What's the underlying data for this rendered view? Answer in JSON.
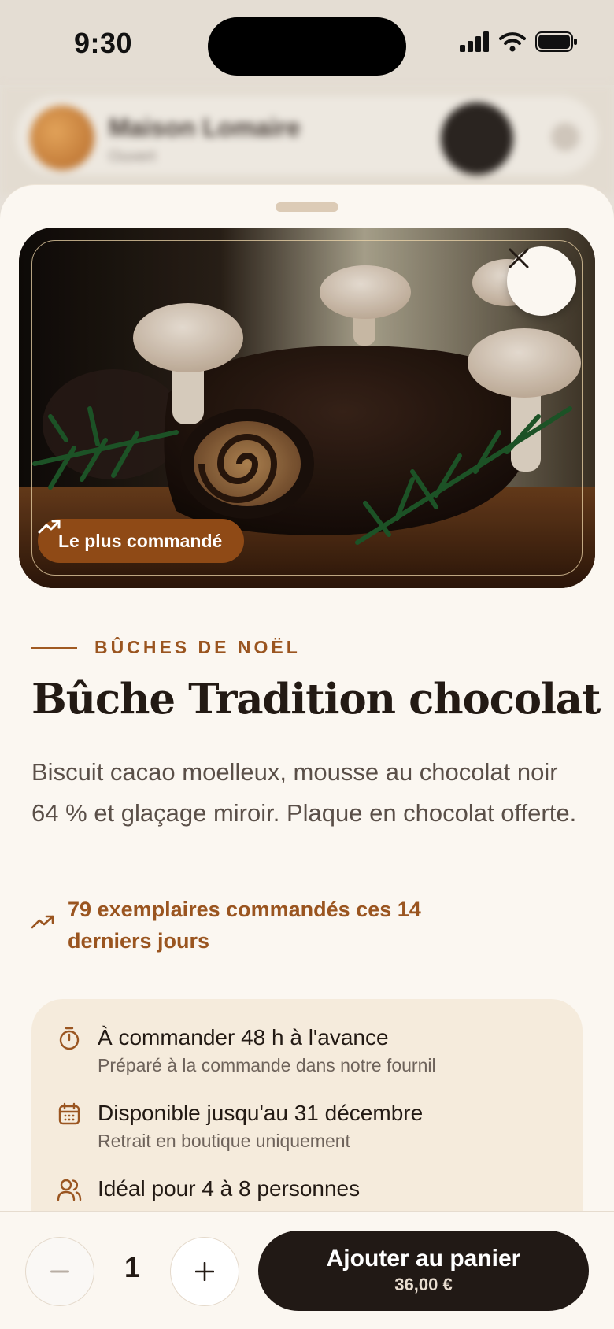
{
  "status_bar": {
    "time": "9:30",
    "icons": [
      "signal-icon",
      "wifi-icon",
      "battery-icon"
    ]
  },
  "background_header": {
    "title": "Maison Lomaire",
    "subtitle": "Ouvert"
  },
  "product": {
    "badge": "Le plus commandé",
    "category": "BÛCHES DE NOËL",
    "name": "Bûche Tradition chocolat",
    "description": "Biscuit cacao moelleux, mousse au chocolat noir 64 % et glaçage miroir. Plaque en chocolat offerte.",
    "popularity": "79 exemplaires commandés ces 14 derniers jours",
    "info": [
      {
        "icon": "timer-icon",
        "main": "À commander 48 h à l'avance",
        "sub": "Préparé à la commande dans notre fournil"
      },
      {
        "icon": "calendar-icon",
        "main": "Disponible jusqu'au 31 décembre",
        "sub": "Retrait en boutique uniquement"
      },
      {
        "icon": "users-icon",
        "main": "Idéal pour 4 à 8 personnes",
        "sub": ""
      }
    ]
  },
  "cart": {
    "quantity": "1",
    "decrement": "−",
    "increment": "+",
    "add_label": "Ajouter au panier",
    "price": "36,00 €"
  },
  "colors": {
    "accent": "#9a5520",
    "badge": "#8f4a16",
    "sheet": "#fbf7f1",
    "card": "#f5ebdc",
    "dark_button": "#211915"
  }
}
